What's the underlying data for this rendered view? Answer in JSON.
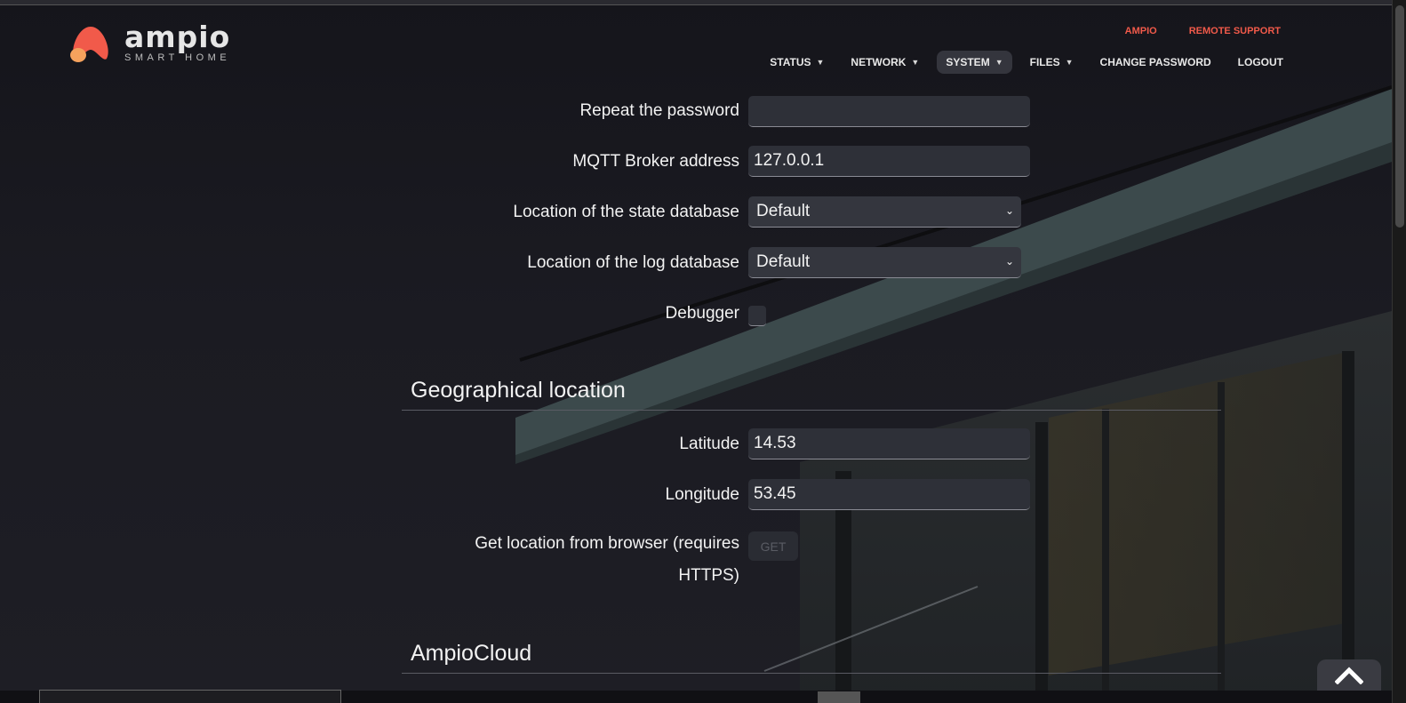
{
  "brand": {
    "name": "ampio",
    "tagline": "SMART HOME",
    "accent_color": "#f15a4a",
    "logo_icon": "ampio-logo-icon"
  },
  "top_links": [
    {
      "label": "AMPIO"
    },
    {
      "label": "REMOTE SUPPORT"
    }
  ],
  "nav": [
    {
      "label": "STATUS",
      "has_caret": true,
      "active": false
    },
    {
      "label": "NETWORK",
      "has_caret": true,
      "active": false
    },
    {
      "label": "SYSTEM",
      "has_caret": true,
      "active": true
    },
    {
      "label": "FILES",
      "has_caret": true,
      "active": false
    },
    {
      "label": "CHANGE PASSWORD",
      "has_caret": false,
      "active": false
    },
    {
      "label": "LOGOUT",
      "has_caret": false,
      "active": false
    }
  ],
  "form": {
    "repeat_password": {
      "label": "Repeat the password",
      "value": ""
    },
    "mqtt_broker": {
      "label": "MQTT Broker address",
      "value": "127.0.0.1"
    },
    "state_db": {
      "label": "Location of the state database",
      "value": "Default"
    },
    "log_db": {
      "label": "Location of the log database",
      "value": "Default"
    },
    "debugger": {
      "label": "Debugger",
      "checked": false
    }
  },
  "geo": {
    "title": "Geographical location",
    "latitude": {
      "label": "Latitude",
      "value": "14.53"
    },
    "longitude": {
      "label": "Longitude",
      "value": "53.45"
    },
    "browser_location": {
      "label_line1": "Get location from browser (requires",
      "label_line2": "HTTPS)",
      "button": "GET"
    }
  },
  "cloud": {
    "title": "AmpioCloud"
  },
  "scroll_top_icon": "chevron-up-icon"
}
